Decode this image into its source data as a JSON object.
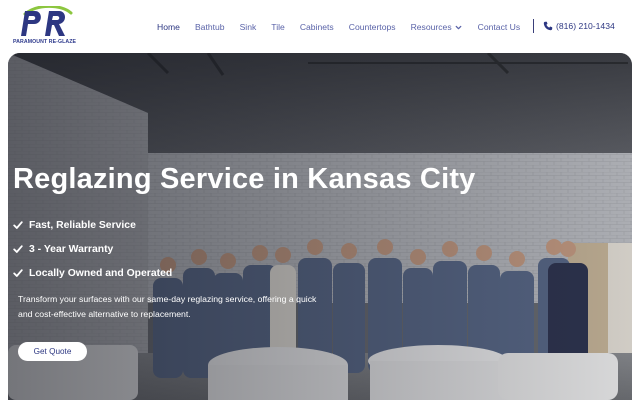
{
  "brand": {
    "logo_letters": "PR",
    "name": "PARAMOUNT RE-GLAZE",
    "primary_color": "#2d3782",
    "accent_color": "#8cc63f"
  },
  "nav": {
    "items": [
      {
        "label": "Home",
        "active": true
      },
      {
        "label": "Bathtub",
        "active": false
      },
      {
        "label": "Sink",
        "active": false
      },
      {
        "label": "Tile",
        "active": false
      },
      {
        "label": "Cabinets",
        "active": false
      },
      {
        "label": "Countertops",
        "active": false
      },
      {
        "label": "Resources",
        "active": false,
        "dropdown": true,
        "icon": "chevron-down-icon"
      },
      {
        "label": "Contact Us",
        "active": false
      }
    ],
    "phone": {
      "icon": "phone-icon",
      "label": "(816) 210-1434"
    }
  },
  "hero": {
    "title": "Reglazing Service in Kansas City",
    "features": [
      {
        "icon": "check-icon",
        "label": "Fast, Reliable Service"
      },
      {
        "icon": "check-icon",
        "label": "3 - Year Warranty"
      },
      {
        "icon": "check-icon",
        "label": "Locally Owned and Operated"
      }
    ],
    "description": "Transform your surfaces with our same-day reglazing service, offering a quick and cost-effective alternative to replacement.",
    "cta_label": "Get Quote",
    "image_description_icon": "team-photo"
  }
}
